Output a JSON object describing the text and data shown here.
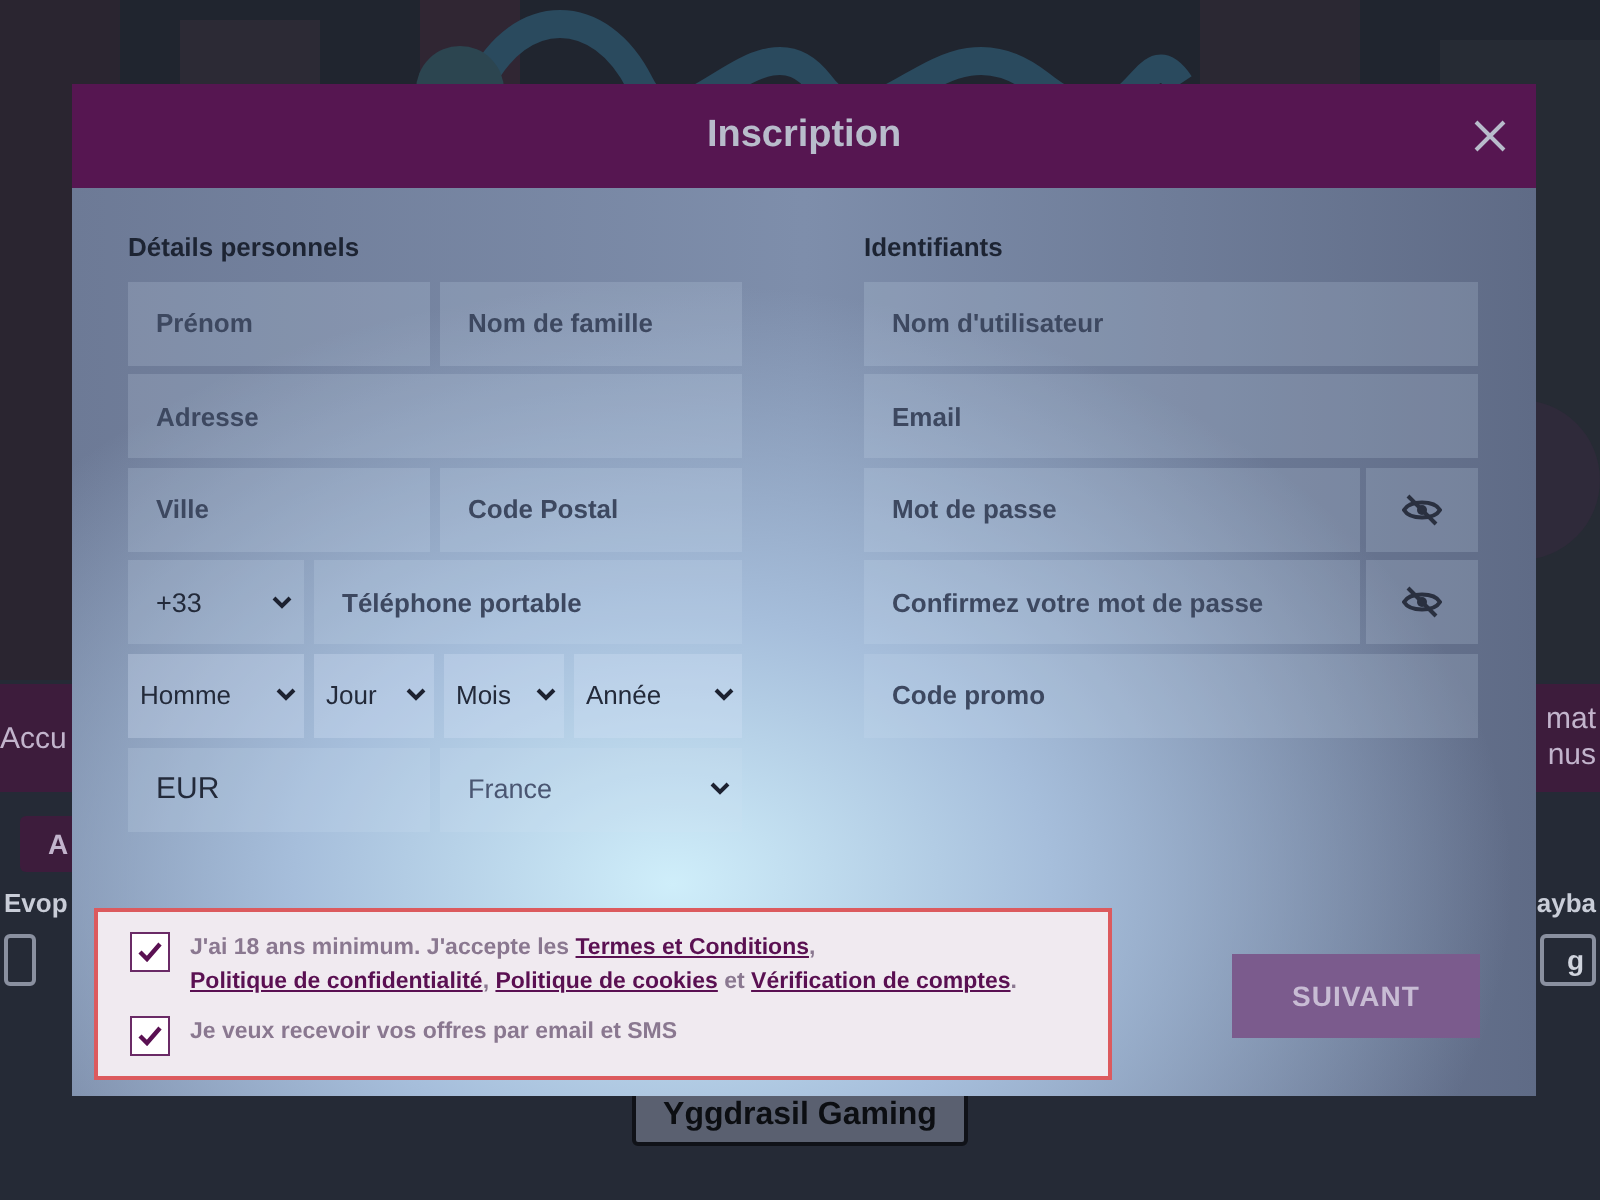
{
  "background": {
    "strip_left": "Accu",
    "strip_right": [
      "mat",
      "nus"
    ],
    "tab": "A",
    "label_left": "Evop",
    "label_right": "ayba",
    "button_right": "g",
    "provider_button": "Yggdrasil Gaming"
  },
  "dialog": {
    "title": "Inscription",
    "personal": {
      "heading": "Détails personnels",
      "rows": [
        [
          {
            "kind": "input",
            "placeholder": "Prénom"
          },
          {
            "kind": "input",
            "placeholder": "Nom de famille"
          }
        ],
        [
          {
            "kind": "input",
            "placeholder": "Adresse"
          }
        ],
        [
          {
            "kind": "input",
            "placeholder": "Ville"
          },
          {
            "kind": "input",
            "placeholder": "Code Postal"
          }
        ],
        [
          {
            "kind": "select",
            "value": "+33"
          },
          {
            "kind": "input",
            "placeholder": "Téléphone portable"
          }
        ],
        [
          {
            "kind": "select",
            "value": "Homme"
          },
          {
            "kind": "select",
            "value": "Jour"
          },
          {
            "kind": "select",
            "value": "Mois"
          },
          {
            "kind": "select",
            "value": "Année"
          }
        ],
        [
          {
            "kind": "value",
            "value": "EUR"
          },
          {
            "kind": "select",
            "value": "France",
            "muted": true
          }
        ]
      ]
    },
    "credentials": {
      "heading": "Identifiants",
      "rows": [
        [
          {
            "kind": "input",
            "placeholder": "Nom d'utilisateur"
          }
        ],
        [
          {
            "kind": "input",
            "placeholder": "Email"
          }
        ],
        [
          {
            "kind": "password",
            "placeholder": "Mot de passe"
          }
        ],
        [
          {
            "kind": "password",
            "placeholder": "Confirmez votre mot de passe"
          }
        ],
        [
          {
            "kind": "input",
            "placeholder": "Code promo"
          }
        ]
      ]
    },
    "consents": [
      {
        "checked": true,
        "parts": [
          {
            "text": "J'ai 18 ans minimum. J'accepte les "
          },
          {
            "link": "Termes et Conditions"
          },
          {
            "text": ", "
          },
          {
            "link": "Politique de confidentialité"
          },
          {
            "text": ", "
          },
          {
            "link": "Politique de cookies"
          },
          {
            "text": " et "
          },
          {
            "link": "Vérification de comptes"
          },
          {
            "text": "."
          }
        ]
      },
      {
        "checked": true,
        "parts": [
          {
            "text": "Je veux recevoir vos offres par email et SMS"
          }
        ]
      }
    ],
    "next_button": "SUIVANT"
  }
}
